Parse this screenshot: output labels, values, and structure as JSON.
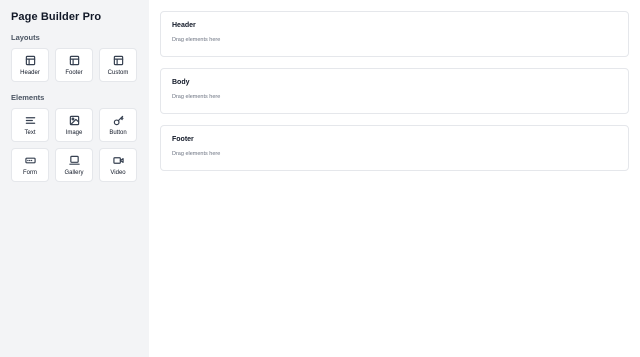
{
  "app": {
    "title": "Page Builder Pro"
  },
  "sidebar": {
    "layouts_title": "Layouts",
    "layouts": [
      {
        "label": "Header",
        "icon": "layout-header-icon"
      },
      {
        "label": "Footer",
        "icon": "layout-footer-icon"
      },
      {
        "label": "Custom",
        "icon": "layout-custom-icon"
      }
    ],
    "elements_title": "Elements",
    "elements": [
      {
        "label": "Text",
        "icon": "text-lines-icon"
      },
      {
        "label": "Image",
        "icon": "image-icon"
      },
      {
        "label": "Button",
        "icon": "button-click-icon"
      },
      {
        "label": "Form",
        "icon": "form-input-icon"
      },
      {
        "label": "Gallery",
        "icon": "gallery-icon"
      },
      {
        "label": "Video",
        "icon": "video-camera-icon"
      }
    ]
  },
  "canvas": {
    "sections": [
      {
        "title": "Header",
        "hint": "Drag elements here"
      },
      {
        "title": "Body",
        "hint": "Drag elements here"
      },
      {
        "title": "Footer",
        "hint": "Drag elements here"
      }
    ]
  },
  "colors": {
    "sidebar_bg": "#f3f4f6",
    "border": "#e5e7eb",
    "text_primary": "#111827",
    "text_muted": "#6b7280"
  }
}
